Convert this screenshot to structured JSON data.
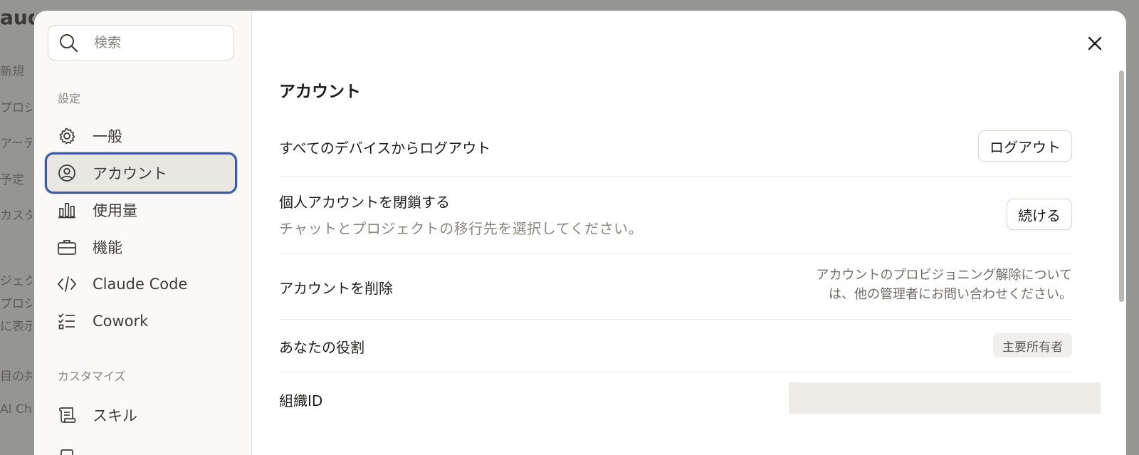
{
  "background": {
    "logo": "aude",
    "items": [
      "新規",
      "プロジ",
      "アーテ",
      "予定",
      "カスタ",
      "ジェク",
      "プロジ",
      "に表示",
      "目の共",
      "AI Ch"
    ]
  },
  "sidebar": {
    "search_placeholder": "検索",
    "section_settings": "設定",
    "items": [
      {
        "label": "一般",
        "icon": "gear-icon"
      },
      {
        "label": "アカウント",
        "icon": "user-circle-icon"
      },
      {
        "label": "使用量",
        "icon": "bar-chart-icon"
      },
      {
        "label": "機能",
        "icon": "briefcase-icon"
      },
      {
        "label": "Claude Code",
        "icon": "code-icon"
      },
      {
        "label": "Cowork",
        "icon": "checklist-icon"
      }
    ],
    "section_customize": "カスタマイズ",
    "custom_items": [
      {
        "label": "スキル",
        "icon": "scroll-icon"
      }
    ],
    "active_item": "アカウント"
  },
  "content": {
    "title": "アカウント",
    "rows": {
      "logout_all": {
        "label": "すべてのデバイスからログアウト",
        "button": "ログアウト"
      },
      "close_account": {
        "label": "個人アカウントを閉鎖する",
        "sub": "チャットとプロジェクトの移行先を選択してください。",
        "button": "続ける"
      },
      "delete_account": {
        "label": "アカウントを削除",
        "note_line1": "アカウントのプロビジョニング解除について",
        "note_line2": "は、他の管理者にお問い合わせください。"
      },
      "role": {
        "label": "あなたの役割",
        "badge": "主要所有者"
      },
      "org_id": {
        "label": "組織ID"
      }
    }
  },
  "colors": {
    "accent_focus": "#3b5ba5",
    "active_bg": "#e9e7e2",
    "sidebar_bg": "#faf9f7",
    "overlay": "#959593"
  }
}
